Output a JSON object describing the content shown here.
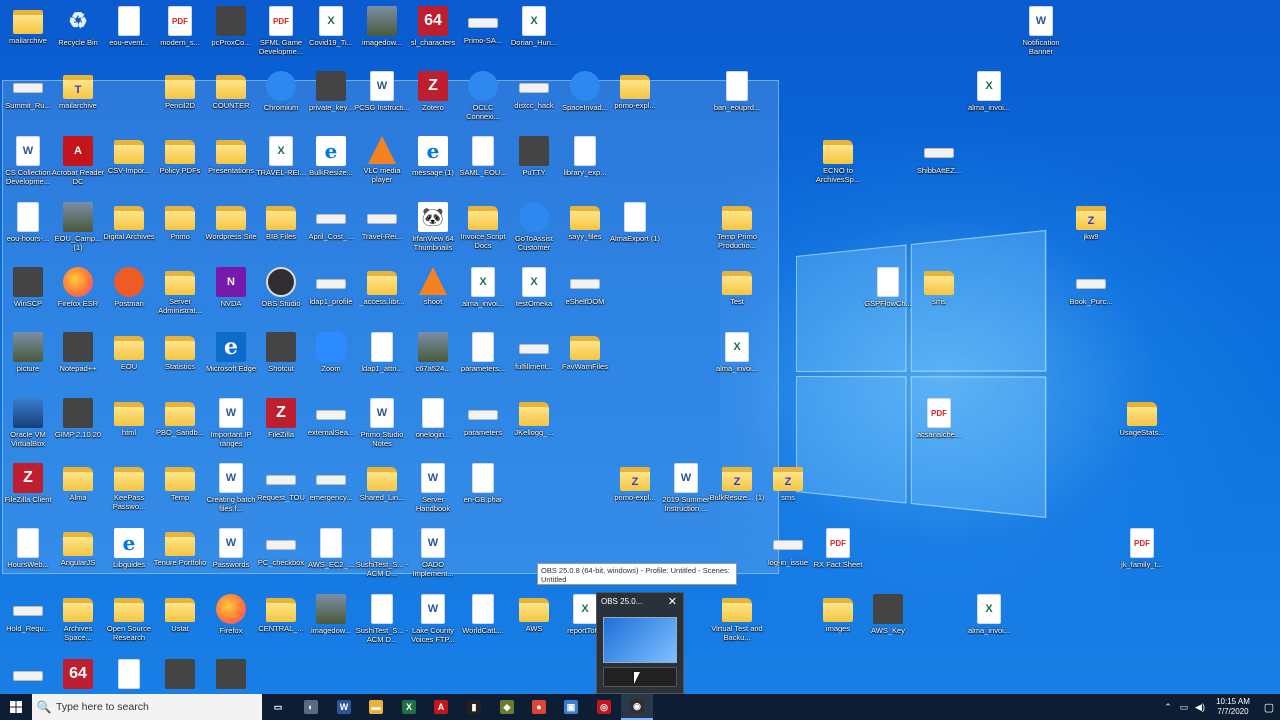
{
  "desktop": {
    "icons": [
      {
        "label": "mailarchive",
        "type": "zip"
      },
      {
        "label": "Recycle Bin",
        "type": "recycle"
      },
      {
        "label": "eou-event...",
        "type": "doc"
      },
      {
        "label": "modern_s...",
        "type": "pdf",
        "glyph": "PDF"
      },
      {
        "label": "pcProxCo...",
        "type": "app2"
      },
      {
        "label": "SFML Game Developme...",
        "type": "pdf",
        "glyph": "PDF"
      },
      {
        "label": "Covid19_Ti...",
        "type": "excel",
        "glyph": "X"
      },
      {
        "label": "imagedow...",
        "type": "photo"
      },
      {
        "label": "sl_characters",
        "type": "filezilla",
        "glyph": "64"
      },
      {
        "label": "Primo-SA...",
        "type": "bar"
      },
      {
        "label": "Dorian_Hun...",
        "type": "excel",
        "glyph": "X"
      },
      {
        "label": "Notification Banner",
        "type": "word",
        "glyph": "W"
      },
      {
        "label": "Summit_Ru...",
        "type": "bar"
      },
      {
        "label": "mailarchive",
        "type": "zip",
        "glyph": "T"
      },
      {
        "label": "Pencil2D",
        "type": "folder"
      },
      {
        "label": "COUNTER",
        "type": "folder"
      },
      {
        "label": "Chromium",
        "type": "app"
      },
      {
        "label": "private_key...",
        "type": "app2"
      },
      {
        "label": "PCSG Instructi...",
        "type": "word",
        "glyph": "W"
      },
      {
        "label": "Zotero",
        "type": "filezilla",
        "glyph": "Z"
      },
      {
        "label": "OCLC Connexi...",
        "type": "app"
      },
      {
        "label": "distcc_hack",
        "type": "bar"
      },
      {
        "label": "SpaceInvad...",
        "type": "app"
      },
      {
        "label": "primo-expl...",
        "type": "folder"
      },
      {
        "label": "ban_eouprd...",
        "type": "doc"
      },
      {
        "label": "alma_invoi...",
        "type": "excel",
        "glyph": "X"
      },
      {
        "label": "CS Collection Developme...",
        "type": "word",
        "glyph": "W"
      },
      {
        "label": "Acrobat Reader DC",
        "type": "acrobat",
        "glyph": "A"
      },
      {
        "label": "CSV-Impor...",
        "type": "folder"
      },
      {
        "label": "Policy PDFs",
        "type": "folder"
      },
      {
        "label": "Presentations",
        "type": "folder"
      },
      {
        "label": "TRAVEL-REI...",
        "type": "excel",
        "glyph": "X"
      },
      {
        "label": "BulkResize...",
        "type": "edge",
        "glyph": "e"
      },
      {
        "label": "VLC media player",
        "type": "vlc"
      },
      {
        "label": "message (1)",
        "type": "edge",
        "glyph": "e"
      },
      {
        "label": "SAML_EOU...",
        "type": "doc"
      },
      {
        "label": "PuTTY",
        "type": "app2"
      },
      {
        "label": "library_exp...",
        "type": "doc"
      },
      {
        "label": "ECNO to ArchivesSp...",
        "type": "folder"
      },
      {
        "label": "ShibbAttEZ...",
        "type": "bar"
      },
      {
        "label": "eou-hours-...",
        "type": "doc"
      },
      {
        "label": "EOU_Camp... (1)",
        "type": "photo"
      },
      {
        "label": "Digital Archives",
        "type": "folder"
      },
      {
        "label": "Primo",
        "type": "folder"
      },
      {
        "label": "Wordpress Site",
        "type": "folder"
      },
      {
        "label": "BIB Files",
        "type": "folder"
      },
      {
        "label": "April_Cost_...",
        "type": "bar"
      },
      {
        "label": "Travel-Rei...",
        "type": "bar"
      },
      {
        "label": "IrfanView 64 Thumbnails",
        "type": "panda",
        "glyph": "🐼"
      },
      {
        "label": "Invoice Script Docs",
        "type": "folder"
      },
      {
        "label": "GoToAssist Customer",
        "type": "app"
      },
      {
        "label": "sayy_files",
        "type": "folder"
      },
      {
        "label": "AlmaExport (1)",
        "type": "doc"
      },
      {
        "label": "Temp Primo Productio...",
        "type": "folder"
      },
      {
        "label": "jkw9",
        "type": "zip",
        "glyph": "Z"
      },
      {
        "label": "WinSCP",
        "type": "app2"
      },
      {
        "label": "Firefox ESR",
        "type": "ff"
      },
      {
        "label": "Postman",
        "type": "postman"
      },
      {
        "label": "Server Administrat...",
        "type": "folder"
      },
      {
        "label": "NVDA",
        "type": "onenote",
        "glyph": "N"
      },
      {
        "label": "OBS Studio",
        "type": "obs"
      },
      {
        "label": "ldap1_profile",
        "type": "bar"
      },
      {
        "label": "_access.libr...",
        "type": "folder"
      },
      {
        "label": "shoot",
        "type": "vlc"
      },
      {
        "label": "alma_invoi...",
        "type": "excel",
        "glyph": "X"
      },
      {
        "label": "testOmeka",
        "type": "excel",
        "glyph": "X"
      },
      {
        "label": "eShelfDOM",
        "type": "bar"
      },
      {
        "label": "Test",
        "type": "folder"
      },
      {
        "label": "GSPFlowCh...",
        "type": "doc"
      },
      {
        "label": "sms",
        "type": "folder"
      },
      {
        "label": "Book_Purc...",
        "type": "bar"
      },
      {
        "label": "picture",
        "type": "photo"
      },
      {
        "label": "Notepad++",
        "type": "app2"
      },
      {
        "label": "EOU",
        "type": "folder"
      },
      {
        "label": "Statistics",
        "type": "folder"
      },
      {
        "label": "Microsoft Edge",
        "type": "edge2",
        "glyph": "e"
      },
      {
        "label": "Shotcut",
        "type": "app2"
      },
      {
        "label": "Zoom",
        "type": "zoom"
      },
      {
        "label": "ldap1_attri...",
        "type": "doc"
      },
      {
        "label": "c67a524...",
        "type": "photo"
      },
      {
        "label": "parameters...",
        "type": "doc"
      },
      {
        "label": "fulfillment...",
        "type": "bar"
      },
      {
        "label": "FavWarnFiles",
        "type": "folder"
      },
      {
        "label": "alma_invoi...",
        "type": "excel",
        "glyph": "X"
      },
      {
        "label": "Oracle VM VirtualBox",
        "type": "vbox"
      },
      {
        "label": "GIMP 2.10.20",
        "type": "app2"
      },
      {
        "label": "html",
        "type": "folder"
      },
      {
        "label": "PBO_Sandb...",
        "type": "folder"
      },
      {
        "label": "Important IP ranges",
        "type": "word",
        "glyph": "W"
      },
      {
        "label": "FileZilla",
        "type": "filezilla",
        "glyph": "Z"
      },
      {
        "label": "externalSea...",
        "type": "bar"
      },
      {
        "label": "Primo Studio Notes",
        "type": "word",
        "glyph": "W"
      },
      {
        "label": "onelogin...",
        "type": "doc"
      },
      {
        "label": "parameters",
        "type": "bar"
      },
      {
        "label": "JKellogg_...",
        "type": "folder"
      },
      {
        "label": "acsanalche...",
        "type": "pdf",
        "glyph": "PDF"
      },
      {
        "label": "UsageStats...",
        "type": "folder"
      },
      {
        "label": "FileZilla Client",
        "type": "filezilla",
        "glyph": "Z"
      },
      {
        "label": "Alma",
        "type": "folder"
      },
      {
        "label": "KeePass Passwo...",
        "type": "folder"
      },
      {
        "label": "Temp",
        "type": "folder"
      },
      {
        "label": "Creating batch files f...",
        "type": "word",
        "glyph": "W"
      },
      {
        "label": "Request_TOU",
        "type": "bar"
      },
      {
        "label": "emergency...",
        "type": "bar"
      },
      {
        "label": "Shared_Lin...",
        "type": "folder"
      },
      {
        "label": "Server Handbook",
        "type": "word",
        "glyph": "W"
      },
      {
        "label": "en-GB.phar",
        "type": "doc"
      },
      {
        "label": "primo-expl...",
        "type": "zip",
        "glyph": "Z"
      },
      {
        "label": "2019 Summer Instruction ...",
        "type": "word",
        "glyph": "W"
      },
      {
        "label": "BulkResize... (1)",
        "type": "zip",
        "glyph": "Z"
      },
      {
        "label": "sms",
        "type": "zip",
        "glyph": "Z"
      },
      {
        "label": "HoursWeb...",
        "type": "doc"
      },
      {
        "label": "AngularJS",
        "type": "folder"
      },
      {
        "label": "Libguides",
        "type": "edge",
        "glyph": "e"
      },
      {
        "label": "Tenure Portfolio",
        "type": "folder"
      },
      {
        "label": "Passwords",
        "type": "word",
        "glyph": "W"
      },
      {
        "label": "PC_checkbox",
        "type": "bar"
      },
      {
        "label": "AWS_EC2_...",
        "type": "doc"
      },
      {
        "label": "SushiTest_S... - ACM D...",
        "type": "doc"
      },
      {
        "label": "OADO Implement...",
        "type": "word",
        "glyph": "W"
      },
      {
        "label": "log-in_issue",
        "type": "bar"
      },
      {
        "label": "RX Fact Sheet",
        "type": "pdf",
        "glyph": "PDF"
      },
      {
        "label": "jk_family_t...",
        "type": "pdf",
        "glyph": "PDF"
      },
      {
        "label": "Hold_Requ...",
        "type": "bar"
      },
      {
        "label": "Archives Space...",
        "type": "folder"
      },
      {
        "label": "Open Source Research",
        "type": "folder"
      },
      {
        "label": "Ustat",
        "type": "folder"
      },
      {
        "label": "Firefox",
        "type": "ff"
      },
      {
        "label": "CENTRAL_...",
        "type": "folder"
      },
      {
        "label": "imagedow...",
        "type": "photo"
      },
      {
        "label": "SushiTest_S... - ACM D...",
        "type": "doc"
      },
      {
        "label": "Lake County Voices FTP...",
        "type": "word",
        "glyph": "W"
      },
      {
        "label": "WorldCatL...",
        "type": "doc"
      },
      {
        "label": "AWS",
        "type": "folder"
      },
      {
        "label": "reportTot...",
        "type": "excel",
        "glyph": "X"
      },
      {
        "label": "Virtual Test and Backu...",
        "type": "folder"
      },
      {
        "label": "images",
        "type": "folder"
      },
      {
        "label": "AWS_Key",
        "type": "app2"
      },
      {
        "label": "alma_invoi...",
        "type": "excel",
        "glyph": "X"
      },
      {
        "label": "",
        "type": "bar"
      },
      {
        "label": "",
        "type": "filezilla",
        "glyph": "64"
      },
      {
        "label": "",
        "type": "doc"
      },
      {
        "label": "",
        "type": "app2"
      },
      {
        "label": "",
        "type": "app2"
      }
    ]
  },
  "tooltip": {
    "text": "OBS 25.0.8 (64-bit, windows) - Profile: Untitled - Scenes: Untitled"
  },
  "preview": {
    "title": "OBS 25.0...",
    "close": "✕"
  },
  "taskbar": {
    "search_placeholder": "Type here to search",
    "search_icon": "🔍",
    "apps": [
      {
        "name": "task-view",
        "glyph": "▭",
        "color": "#0d1d33"
      },
      {
        "name": "app-a",
        "glyph": "◐",
        "color": "#5a6b80"
      },
      {
        "name": "word",
        "glyph": "W",
        "color": "#2b5797"
      },
      {
        "name": "file-explorer",
        "glyph": "▬",
        "color": "#e8b33b"
      },
      {
        "name": "excel",
        "glyph": "X",
        "color": "#1e7145"
      },
      {
        "name": "acrobat",
        "glyph": "A",
        "color": "#c4151c"
      },
      {
        "name": "terminal",
        "glyph": "▮",
        "color": "#222"
      },
      {
        "name": "app-b",
        "glyph": "◆",
        "color": "#6b7c2e"
      },
      {
        "name": "chrome",
        "glyph": "●",
        "color": "#db4437"
      },
      {
        "name": "virtualbox",
        "glyph": "▣",
        "color": "#3a7fd0"
      },
      {
        "name": "app-c",
        "glyph": "◎",
        "color": "#c4151c"
      },
      {
        "name": "obs",
        "glyph": "◉",
        "color": "#302e31"
      }
    ],
    "tray": {
      "chevron": "⌃",
      "net": "▭",
      "vol": "◀)",
      "clock_time": "10:15 AM",
      "clock_date": "7/7/2020",
      "notif": "▢"
    }
  }
}
